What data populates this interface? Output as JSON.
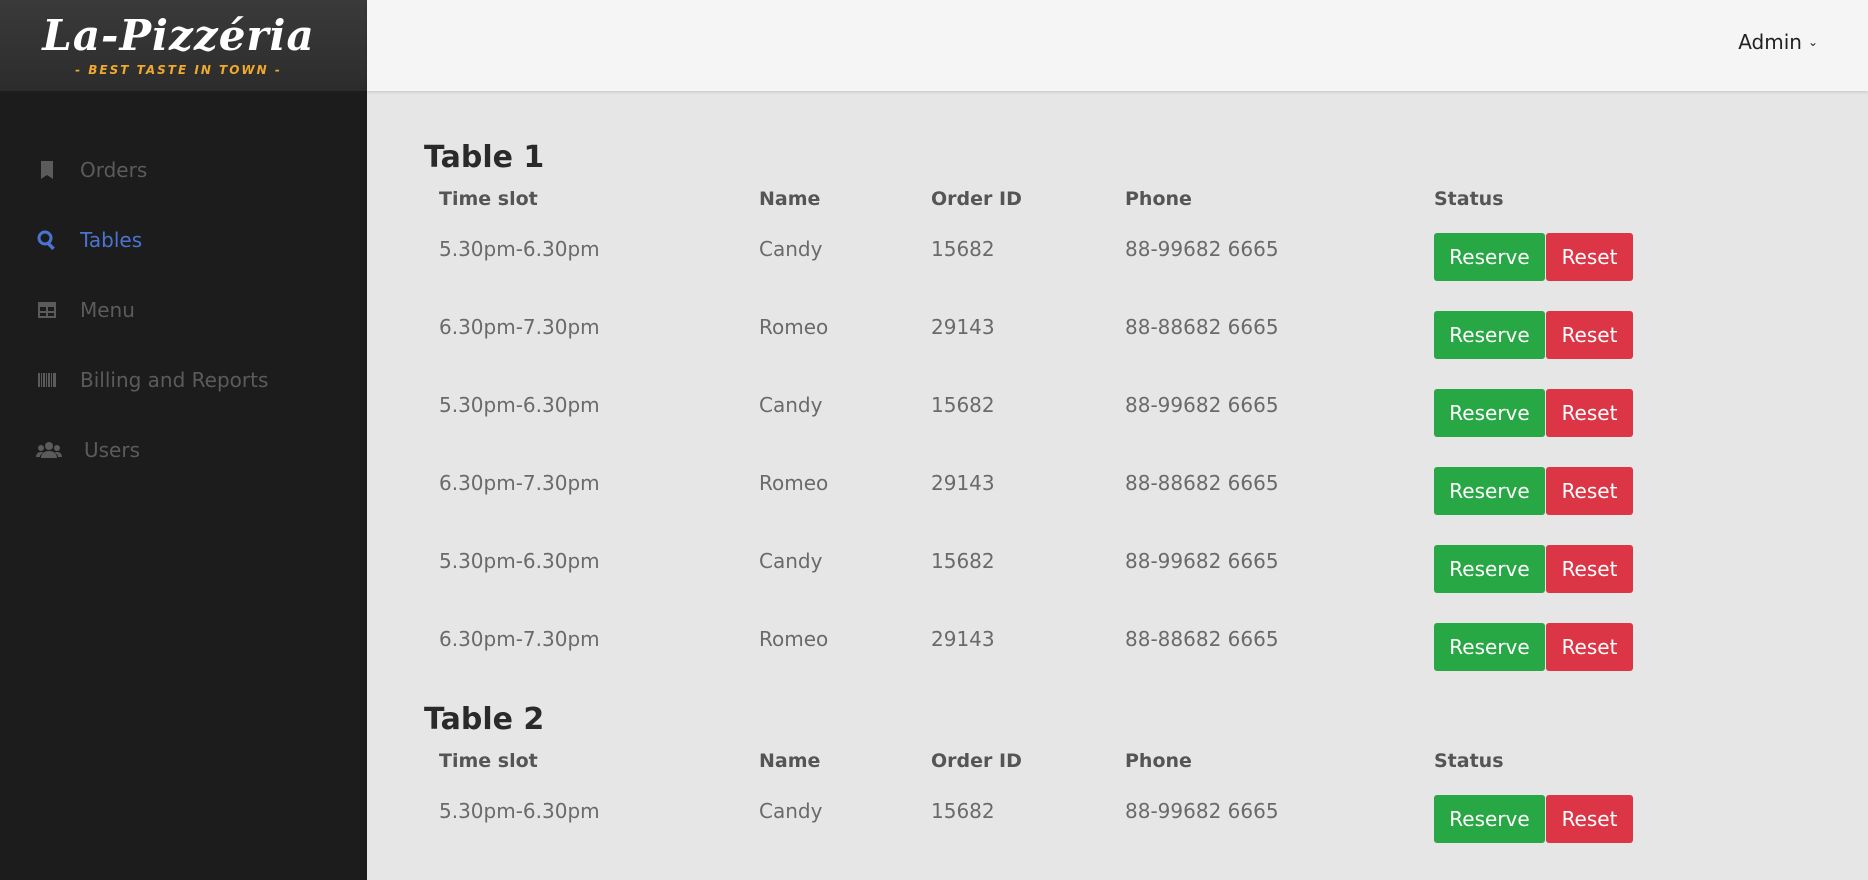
{
  "brand": {
    "title": "La-Pizzéria",
    "tagline": "- BEST TASTE IN TOWN -",
    "accent": "#f0a92d"
  },
  "user_menu": {
    "label": "Admin",
    "icon": "chevron-down-icon"
  },
  "sidebar": {
    "items": [
      {
        "label": "Orders",
        "icon": "bookmark-icon",
        "active": false
      },
      {
        "label": "Tables",
        "icon": "search-icon",
        "active": true
      },
      {
        "label": "Menu",
        "icon": "table-icon",
        "active": false
      },
      {
        "label": "Billing and Reports",
        "icon": "barcode-icon",
        "active": false
      },
      {
        "label": "Users",
        "icon": "users-icon",
        "active": false
      }
    ],
    "active_color": "#4a74d0"
  },
  "columns": [
    "Time slot",
    "Name",
    "Order ID",
    "Phone",
    "Status"
  ],
  "actions": {
    "reserve": "Reserve",
    "reset": "Reset",
    "reserve_color": "#27a844",
    "reset_color": "#dc3545"
  },
  "tables": [
    {
      "title": "Table 1",
      "rows": [
        {
          "slot": "5.30pm-6.30pm",
          "name": "Candy",
          "order_id": "15682",
          "phone": "88-99682 6665"
        },
        {
          "slot": "6.30pm-7.30pm",
          "name": "Romeo",
          "order_id": "29143",
          "phone": "88-88682 6665"
        },
        {
          "slot": "5.30pm-6.30pm",
          "name": "Candy",
          "order_id": "15682",
          "phone": "88-99682 6665"
        },
        {
          "slot": "6.30pm-7.30pm",
          "name": "Romeo",
          "order_id": "29143",
          "phone": "88-88682 6665"
        },
        {
          "slot": "5.30pm-6.30pm",
          "name": "Candy",
          "order_id": "15682",
          "phone": "88-99682 6665"
        },
        {
          "slot": "6.30pm-7.30pm",
          "name": "Romeo",
          "order_id": "29143",
          "phone": "88-88682 6665"
        }
      ]
    },
    {
      "title": "Table 2",
      "rows": [
        {
          "slot": "5.30pm-6.30pm",
          "name": "Candy",
          "order_id": "15682",
          "phone": "88-99682 6665"
        }
      ]
    }
  ]
}
